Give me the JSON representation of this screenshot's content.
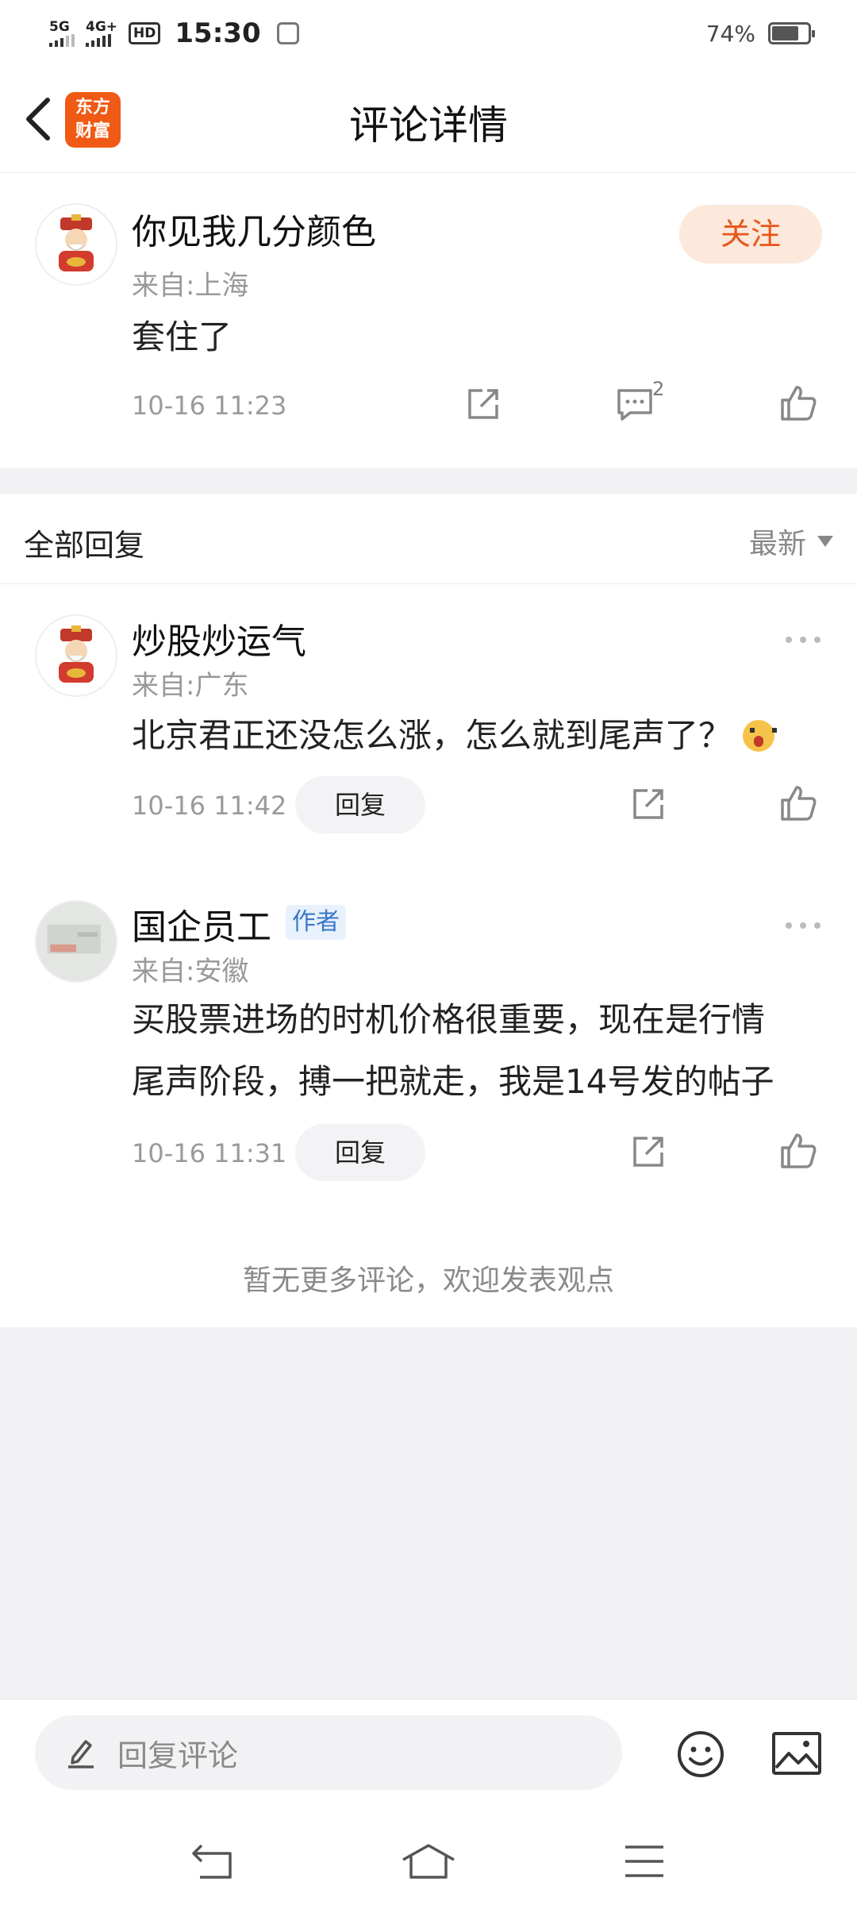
{
  "status_bar": {
    "signal1": "5G",
    "signal2": "4G+",
    "hd": "HD",
    "time": "15:30",
    "battery": "74%"
  },
  "header": {
    "title": "评论详情",
    "logo_line1": "东方",
    "logo_line2": "财富"
  },
  "main_comment": {
    "user": "你见我几分颜色",
    "location": "来自:上海",
    "content": "套住了",
    "time": "10-16 11:23",
    "reply_count": "2",
    "follow_label": "关注"
  },
  "replies_section": {
    "title": "全部回复",
    "sort_label": "最新",
    "replies": [
      {
        "user": "炒股炒运气",
        "location": "来自:广东",
        "content": "北京君正还没怎么涨，怎么就到尾声了？",
        "time": "10-16 11:42",
        "reply_label": "回复"
      },
      {
        "user": "国企员工",
        "author_tag": "作者",
        "location": "来自:安徽",
        "content_line1": "买股票进场的时机价格很重要，现在是行情",
        "content_line2": "尾声阶段，搏一把就走，我是14号发的帖子",
        "time": "10-16 11:31",
        "reply_label": "回复"
      }
    ],
    "no_more_text": "暂无更多评论，欢迎发表观点"
  },
  "bottom_bar": {
    "input_placeholder": "回复评论"
  },
  "colors": {
    "brand": "#f05a14",
    "follow_bg": "#fde8dc",
    "author_tag": "#3a78c9"
  }
}
